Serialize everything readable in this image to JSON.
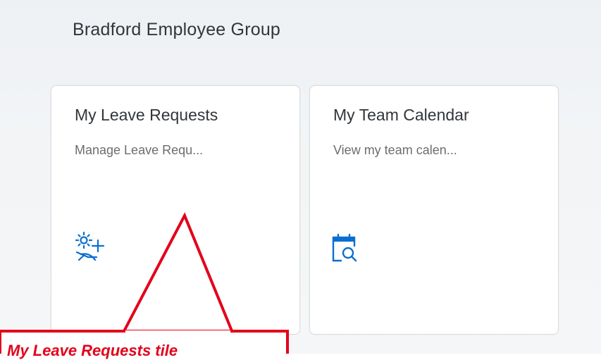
{
  "group": {
    "title": "Bradford Employee Group"
  },
  "tiles": [
    {
      "title": "My Leave Requests",
      "subtitle": "Manage Leave Requ...",
      "icon": "leave-request-icon"
    },
    {
      "title": "My Team Calendar",
      "subtitle": "View my team calen...",
      "icon": "team-calendar-icon"
    }
  ],
  "annotation": {
    "text": "My Leave Requests tile"
  },
  "colors": {
    "icon_blue": "#0a6ed1",
    "annotation_red": "#e3001b",
    "tile_border": "#d9dde1",
    "text_primary": "#32363a",
    "text_secondary": "#6a6d70"
  }
}
